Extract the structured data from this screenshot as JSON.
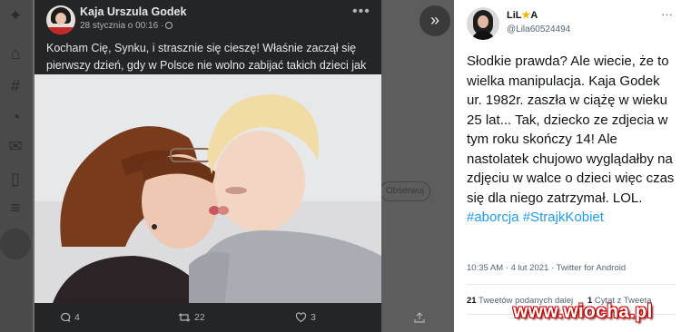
{
  "fb_post": {
    "author": "Kaja Urszula Godek",
    "timestamp": "28 stycznia o 00:16 ·",
    "text": "Kocham Cię, Synku, i strasznie się cieszę! Właśnie zaczął się pierwszy dzień, gdy w Polsce nie wolno zabijać takich dzieci jak Ty",
    "hearts": "❤❤❤",
    "comments_count": "4",
    "shares_count": "22",
    "likes_count": "3"
  },
  "background": {
    "follow_label": "Obserwuj"
  },
  "tweet": {
    "display_name": "LiL",
    "display_name_suffix": "A",
    "handle": "@Lila60524494",
    "text_main": "Słodkie prawda? Ale wiecie, że to wielka manipulacja. Kaja Godek ur. 1982r. zaszła w ciążę w wieku 25 lat... Tak, dziecko ze zdjecia w tym roku skończy 14! Ale nastolatek chujowo wyglądałby na zdjęciu w walce o dzieci więc czas się dla niego zatrzymał. LOL. ",
    "hashtag1": "#aborcja",
    "hashtag2": "#StrajkKobiet",
    "datetime": "10:35 AM · 4 lut 2021 · Twitter for Android",
    "retweets_count": "21",
    "retweets_label": "Tweetów podanych dalej",
    "quotes_count": "1",
    "quotes_label": "Cytat z Tweeta"
  },
  "watermark": "www.wiocha.pl"
}
